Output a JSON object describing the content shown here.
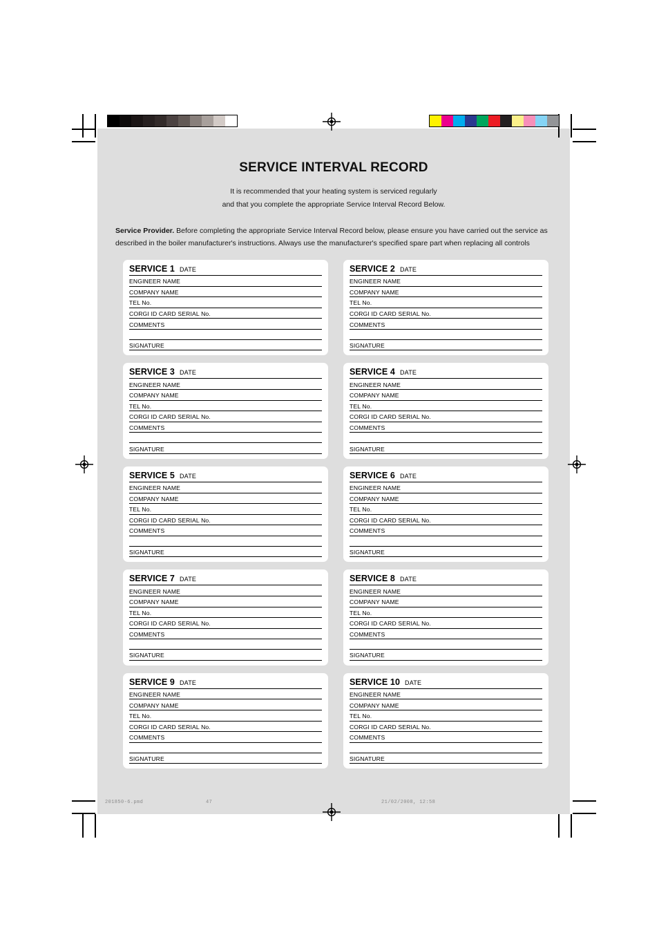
{
  "document": {
    "title": "SERVICE INTERVAL RECORD",
    "intro_line_1": "It is recommended that your heating system is serviced regularly",
    "intro_line_2": "and that you complete the appropriate  Service Interval Record Below.",
    "provider_bold": "Service Provider.",
    "provider_text": " Before completing the appropriate Service Interval Record below, please ensure you have carried out the service as described in the boiler manufacturer's instructions. Always use the manufacturer's specified spare part when replacing all controls"
  },
  "field_labels": {
    "date": "DATE",
    "engineer_name": "ENGINEER NAME",
    "company_name": "COMPANY NAME",
    "tel_no": "TEL No.",
    "corgi_id": "CORGI ID CARD SERIAL No.",
    "comments": "COMMENTS",
    "comments_blank": "",
    "signature": "SIGNATURE"
  },
  "service_cards": [
    {
      "title": "SERVICE 1"
    },
    {
      "title": "SERVICE 2"
    },
    {
      "title": "SERVICE 3"
    },
    {
      "title": "SERVICE 4"
    },
    {
      "title": "SERVICE 5"
    },
    {
      "title": "SERVICE 6"
    },
    {
      "title": "SERVICE 7"
    },
    {
      "title": "SERVICE 8"
    },
    {
      "title": "SERVICE 9"
    },
    {
      "title": "SERVICE 10"
    }
  ],
  "footer": {
    "filename": "201850-6.pmd",
    "page_number": "47",
    "timestamp": "21/02/2008, 12:58"
  },
  "calibration": {
    "grayscale_swatches": [
      "#000000",
      "#0d0a0a",
      "#1b1515",
      "#272020",
      "#332b2a",
      "#4b4241",
      "#625955",
      "#887f7b",
      "#a8a09c",
      "#d3cbc7",
      "#ffffff"
    ],
    "color_swatches": [
      "#fff200",
      "#ec008c",
      "#00adef",
      "#2b3990",
      "#00a65d",
      "#ed1c24",
      "#231f20",
      "#fbf08a",
      "#f78fb9",
      "#85d4f5",
      "#939598"
    ]
  },
  "colors": {
    "page_background": "#dedede",
    "sheet_background": "#ffffff",
    "card_background": "#ffffff",
    "rule_color": "#000000",
    "footer_text": "#8a8a8a"
  }
}
